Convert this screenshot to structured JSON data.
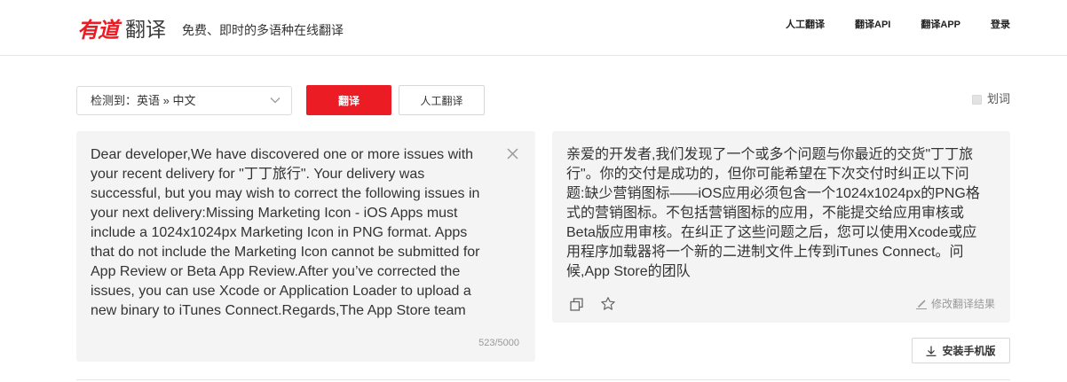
{
  "theme": {
    "brand_red": "#ec1c24",
    "panel_bg": "#f4f4f4"
  },
  "header": {
    "logo_brand": "有道",
    "logo_product": "翻译",
    "slogan": "免费、即时的多语种在线翻译",
    "nav": [
      "人工翻译",
      "翻译API",
      "翻译APP",
      "登录"
    ]
  },
  "toolbar": {
    "language_select": "检测到：英语 » 中文",
    "translate_button": "翻译",
    "human_translation_button": "人工翻译",
    "word_pick": {
      "label": "划词",
      "checked": false
    }
  },
  "input": {
    "text": "Dear developer,We have discovered one or more issues with your recent delivery for \"丁丁旅行\". Your delivery was successful, but you may wish to correct the following issues in your next delivery:Missing Marketing Icon - iOS Apps must include a 1024x1024px Marketing Icon in PNG format. Apps that do not include the Marketing Icon cannot be submitted for App Review or Beta App Review.After you’ve corrected the issues, you can use Xcode or Application Loader to upload a new binary to iTunes Connect.Regards,The App Store team",
    "char_count": "523/5000"
  },
  "output": {
    "lines": [
      "亲爱的开发者,我们发现了一个或多个问题与你最近的交货\"丁丁旅",
      "行\"。你的交付是成功的，但你可能希望在下次交付时纠正以下问",
      "题:缺少营销图标——iOS应用必须包含一个1024x1024px的PNG格",
      "式的营销图标。不包括营销图标的应用，不能提交给应用审核或",
      "Beta版应用审核。在纠正了这些问题之后，您可以使用Xcode或应",
      "用程序加载器将一个新的二进制文件上传到iTunes Connect。问",
      "候,App Store的团队"
    ],
    "edit_label": "修改翻译结果"
  },
  "install_app_button": "安装手机版",
  "icons": {
    "language_select": "chevron-down-icon",
    "clear_input": "close-icon",
    "copy": "copy-icon",
    "favorite": "star-icon",
    "edit": "pencil-icon",
    "install": "download-icon",
    "word_pick_checkbox": "checkbox-icon"
  }
}
